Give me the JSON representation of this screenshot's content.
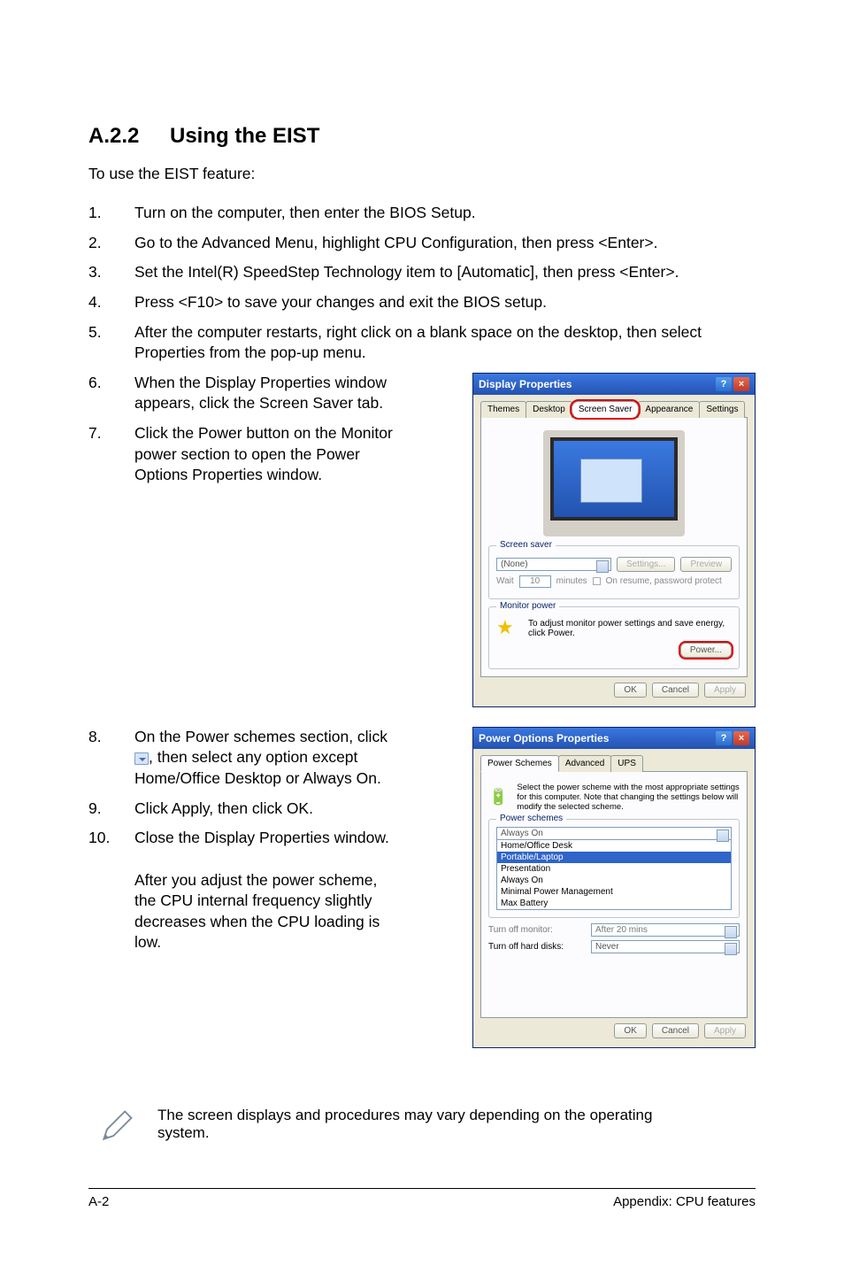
{
  "heading": {
    "number": "A.2.2",
    "title": "Using the EIST"
  },
  "intro": "To use the EIST feature:",
  "steps": {
    "s1": "Turn on the computer, then enter the BIOS Setup.",
    "s2": "Go to the Advanced Menu, highlight CPU Configuration, then press <Enter>.",
    "s3": "Set the Intel(R) SpeedStep Technology item to [Automatic], then press <Enter>.",
    "s4": "Press <F10> to save your changes and exit the BIOS setup.",
    "s5": "After the computer restarts, right click on a blank space on the desktop, then select Properties from the pop-up menu.",
    "s6": "When the Display Properties window appears, click the Screen Saver tab.",
    "s7": "Click the Power button on the Monitor power section to open the Power Options Properties window.",
    "s8a": "On the Power schemes section, click ",
    "s8b": ", then select any option except Home/Office Desktop or Always On.",
    "s9": "Click Apply, then click OK.",
    "s10": "Close the Display Properties window.",
    "s10_after": "After you adjust the power scheme, the CPU internal frequency slightly decreases when the CPU loading is low."
  },
  "note": "The screen displays and procedures may vary depending on the operating system.",
  "footer": {
    "left": "A-2",
    "right": "Appendix: CPU features"
  },
  "display_dialog": {
    "title": "Display Properties",
    "tabs": {
      "themes": "Themes",
      "desktop": "Desktop",
      "screensaver": "Screen Saver",
      "appearance": "Appearance",
      "settings": "Settings"
    },
    "grp_saver": "Screen saver",
    "saver_value": "(None)",
    "btn_settings": "Settings...",
    "btn_preview": "Preview",
    "wait": "Wait",
    "wait_value": "10",
    "minutes": "minutes",
    "resume": "On resume, password protect",
    "grp_monitor": "Monitor power",
    "monitor_text": "To adjust monitor power settings and save energy, click Power.",
    "btn_power": "Power...",
    "ok": "OK",
    "cancel": "Cancel",
    "apply": "Apply"
  },
  "power_dialog": {
    "title": "Power Options Properties",
    "tabs": {
      "schemes": "Power Schemes",
      "advanced": "Advanced",
      "ups": "UPS"
    },
    "desc": "Select the power scheme with the most appropriate settings for this computer. Note that changing the settings below will modify the selected scheme.",
    "grp_schemes": "Power schemes",
    "scheme_value": "Always On",
    "options": {
      "o1": "Home/Office Desk",
      "o2": "Portable/Laptop",
      "o3": "Presentation",
      "o4": "Always On",
      "o5": "Minimal Power Management",
      "o6": "Max Battery"
    },
    "turn_off_monitor": "Turn off monitor:",
    "monitor_value": "After 20 mins",
    "turn_off_hd": "Turn off hard disks:",
    "hd_value": "Never",
    "ok": "OK",
    "cancel": "Cancel",
    "apply": "Apply"
  }
}
